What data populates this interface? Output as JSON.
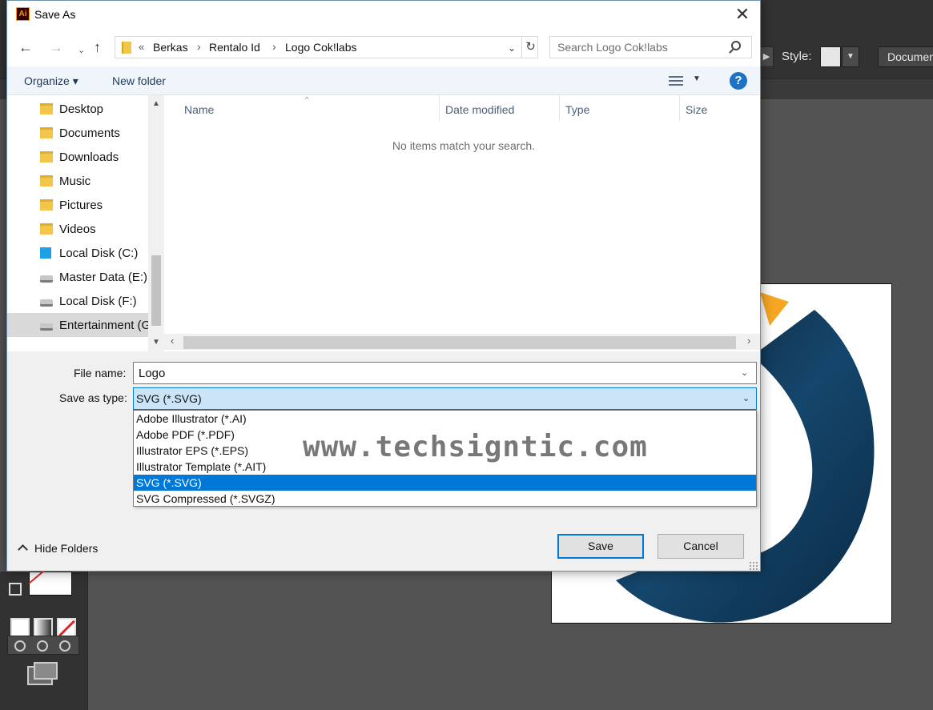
{
  "dialog": {
    "title": "Save As",
    "app_icon_text": "Ai",
    "close_glyph": "✕"
  },
  "navigation": {
    "back_glyph": "←",
    "forward_glyph": "→",
    "recent_glyph": "⌄",
    "up_glyph": "↑",
    "breadcrumb_prefix": "«",
    "breadcrumb": [
      "Berkas",
      "Rentalo Id",
      "Logo Cok!labs"
    ],
    "breadcrumb_sep": "›",
    "address_dropdown_glyph": "⌄",
    "refresh_glyph": "↻",
    "search_placeholder": "Search Logo Cok!labs"
  },
  "command_bar": {
    "organize_label": "Organize ▾",
    "new_folder_label": "New folder",
    "view_dropdown_glyph": "▼",
    "help_glyph": "?"
  },
  "nav_pane": {
    "items": [
      {
        "label": "Desktop",
        "icon": "folder-icon"
      },
      {
        "label": "Documents",
        "icon": "folder-icon"
      },
      {
        "label": "Downloads",
        "icon": "folder-icon"
      },
      {
        "label": "Music",
        "icon": "folder-icon"
      },
      {
        "label": "Pictures",
        "icon": "folder-icon"
      },
      {
        "label": "Videos",
        "icon": "folder-icon"
      },
      {
        "label": "Local Disk (C:)",
        "icon": "windows-drive-icon"
      },
      {
        "label": "Master Data (E:)",
        "icon": "drive-icon"
      },
      {
        "label": "Local Disk (F:)",
        "icon": "drive-icon"
      },
      {
        "label": "Entertainment (G",
        "icon": "drive-icon"
      }
    ],
    "selected_index": 9,
    "scroll_up_glyph": "▲",
    "scroll_down_glyph": "▼"
  },
  "file_list": {
    "columns": [
      "Name",
      "Date modified",
      "Type",
      "Size"
    ],
    "sort_glyph": "^",
    "empty_message": "No items match your search.",
    "scroll_left_glyph": "‹",
    "scroll_right_glyph": "›"
  },
  "form": {
    "file_name_label": "File name:",
    "file_name_value": "Logo",
    "save_as_type_label": "Save as type:",
    "save_as_type_value": "SVG (*.SVG)",
    "dropdown_glyph": "⌄",
    "type_options": [
      "Adobe Illustrator (*.AI)",
      "Adobe PDF (*.PDF)",
      "Illustrator EPS (*.EPS)",
      "Illustrator Template (*.AIT)",
      "SVG (*.SVG)",
      "SVG Compressed (*.SVGZ)"
    ],
    "selected_type_index": 4
  },
  "footer": {
    "hide_folders_label": "Hide Folders",
    "save_label": "Save",
    "cancel_label": "Cancel"
  },
  "illustrator": {
    "style_label": "Style:",
    "document_button_label": "Documen",
    "style_arrow_glyph": "▶",
    "style_dropdown_glyph": "▼"
  },
  "watermark": "www.techsigntic.com",
  "colors": {
    "accent": "#0078d7",
    "selection_bg": "#cce4f7",
    "app_bg": "#535353",
    "logo_orange": "#f5a623",
    "logo_navy": "#0f2f4b"
  }
}
